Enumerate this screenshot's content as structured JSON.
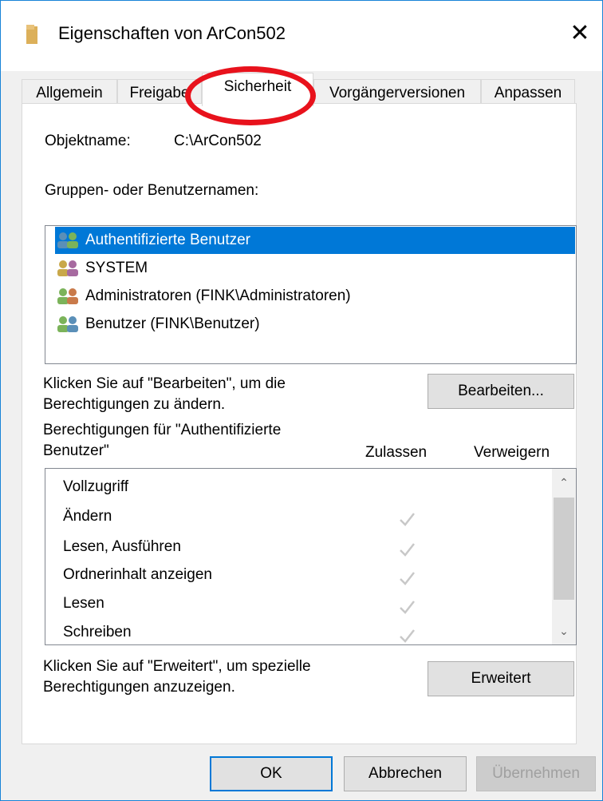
{
  "window": {
    "title": "Eigenschaften von ArCon502",
    "close_glyph": "✕"
  },
  "tabs": [
    {
      "label": "Allgemein"
    },
    {
      "label": "Freigabe"
    },
    {
      "label": "Sicherheit",
      "active": true
    },
    {
      "label": "Vorgängerversionen"
    },
    {
      "label": "Anpassen"
    }
  ],
  "object": {
    "label": "Objektname:",
    "value": "C:\\ArCon502"
  },
  "groups": {
    "label": "Gruppen- oder Benutzernamen:",
    "items": [
      {
        "label": "Authentifizierte Benutzer",
        "icon": "users-icon",
        "selected": true
      },
      {
        "label": "SYSTEM",
        "icon": "users-icon"
      },
      {
        "label": "Administratoren (FINK\\Administratoren)",
        "icon": "users-icon"
      },
      {
        "label": "Benutzer (FINK\\Benutzer)",
        "icon": "users-icon"
      }
    ]
  },
  "edit": {
    "hint_line1": "Klicken Sie auf \"Bearbeiten\", um die",
    "hint_line2": "Berechtigungen zu ändern.",
    "button_label": "Bearbeiten..."
  },
  "permissions": {
    "heading_line1": "Berechtigungen für \"Authentifizierte",
    "heading_line2": "Benutzer\"",
    "col_allow": "Zulassen",
    "col_deny": "Verweigern",
    "rows": [
      {
        "label": "Vollzugriff",
        "allow": false
      },
      {
        "label": "Ändern",
        "allow": true
      },
      {
        "label": "Lesen, Ausführen",
        "allow": true
      },
      {
        "label": "Ordnerinhalt anzeigen",
        "allow": true
      },
      {
        "label": "Lesen",
        "allow": true
      },
      {
        "label": "Schreiben",
        "allow": true
      }
    ],
    "scroll_up_glyph": "⌃",
    "scroll_down_glyph": "⌄"
  },
  "advanced": {
    "hint_line1": "Klicken Sie auf \"Erweitert\", um spezielle",
    "hint_line2": "Berechtigungen anzuzeigen.",
    "button_label": "Erweitert"
  },
  "footer": {
    "ok_label": "OK",
    "cancel_label": "Abbrechen",
    "apply_label": "Übernehmen"
  },
  "colors": {
    "selection": "#0078d7",
    "highlight_ring": "#e8121c",
    "check_gray": "#c8c8c8"
  }
}
